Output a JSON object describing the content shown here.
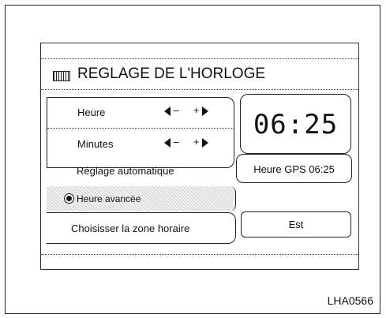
{
  "screen": {
    "title": "REGLAGE DE L'HORLOGE",
    "title_icon": "keyboard-icon"
  },
  "menu": {
    "hour_label": "Heure",
    "minute_label": "Minutes",
    "stepper_minus": "–",
    "stepper_plus": "+",
    "auto_label": "Réglage automatique",
    "dst_label": "Heure avancée",
    "zone_label": "Choisisser la zone horaire"
  },
  "clock": {
    "time": "06:25",
    "gps_label": "Heure GPS 06:25"
  },
  "zone": {
    "value": "Est"
  },
  "figure": {
    "ref": "LHA0566"
  }
}
